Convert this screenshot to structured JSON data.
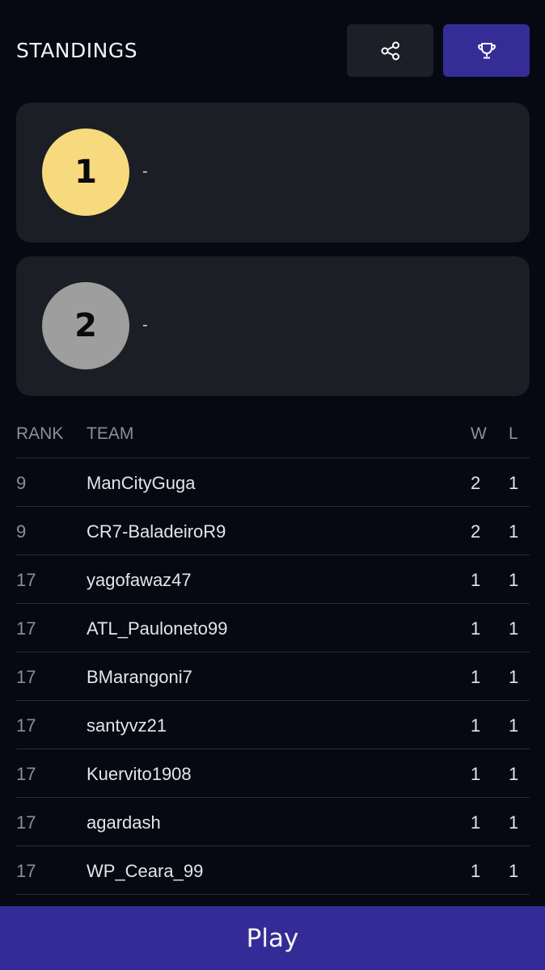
{
  "header": {
    "title": "STANDINGS",
    "share_icon": "share-icon",
    "trophy_icon": "trophy-icon",
    "accent": "#352d96"
  },
  "podium": [
    {
      "rank": "1",
      "name": "-",
      "color": "#f7da7d"
    },
    {
      "rank": "2",
      "name": "-",
      "color": "#9e9e9e"
    }
  ],
  "table": {
    "headers": {
      "rank": "RANK",
      "team": "TEAM",
      "w": "W",
      "l": "L"
    },
    "rows": [
      {
        "rank": "9",
        "team": "ManCityGuga",
        "w": "2",
        "l": "1"
      },
      {
        "rank": "9",
        "team": "CR7-BaladeiroR9",
        "w": "2",
        "l": "1"
      },
      {
        "rank": "17",
        "team": "yagofawaz47",
        "w": "1",
        "l": "1"
      },
      {
        "rank": "17",
        "team": "ATL_Pauloneto99",
        "w": "1",
        "l": "1"
      },
      {
        "rank": "17",
        "team": "BMarangoni7",
        "w": "1",
        "l": "1"
      },
      {
        "rank": "17",
        "team": "santyvz21",
        "w": "1",
        "l": "1"
      },
      {
        "rank": "17",
        "team": "Kuervito1908",
        "w": "1",
        "l": "1"
      },
      {
        "rank": "17",
        "team": "agardash",
        "w": "1",
        "l": "1"
      },
      {
        "rank": "17",
        "team": "WP_Ceara_99",
        "w": "1",
        "l": "1"
      }
    ]
  },
  "footer": {
    "play_label": "Play"
  }
}
